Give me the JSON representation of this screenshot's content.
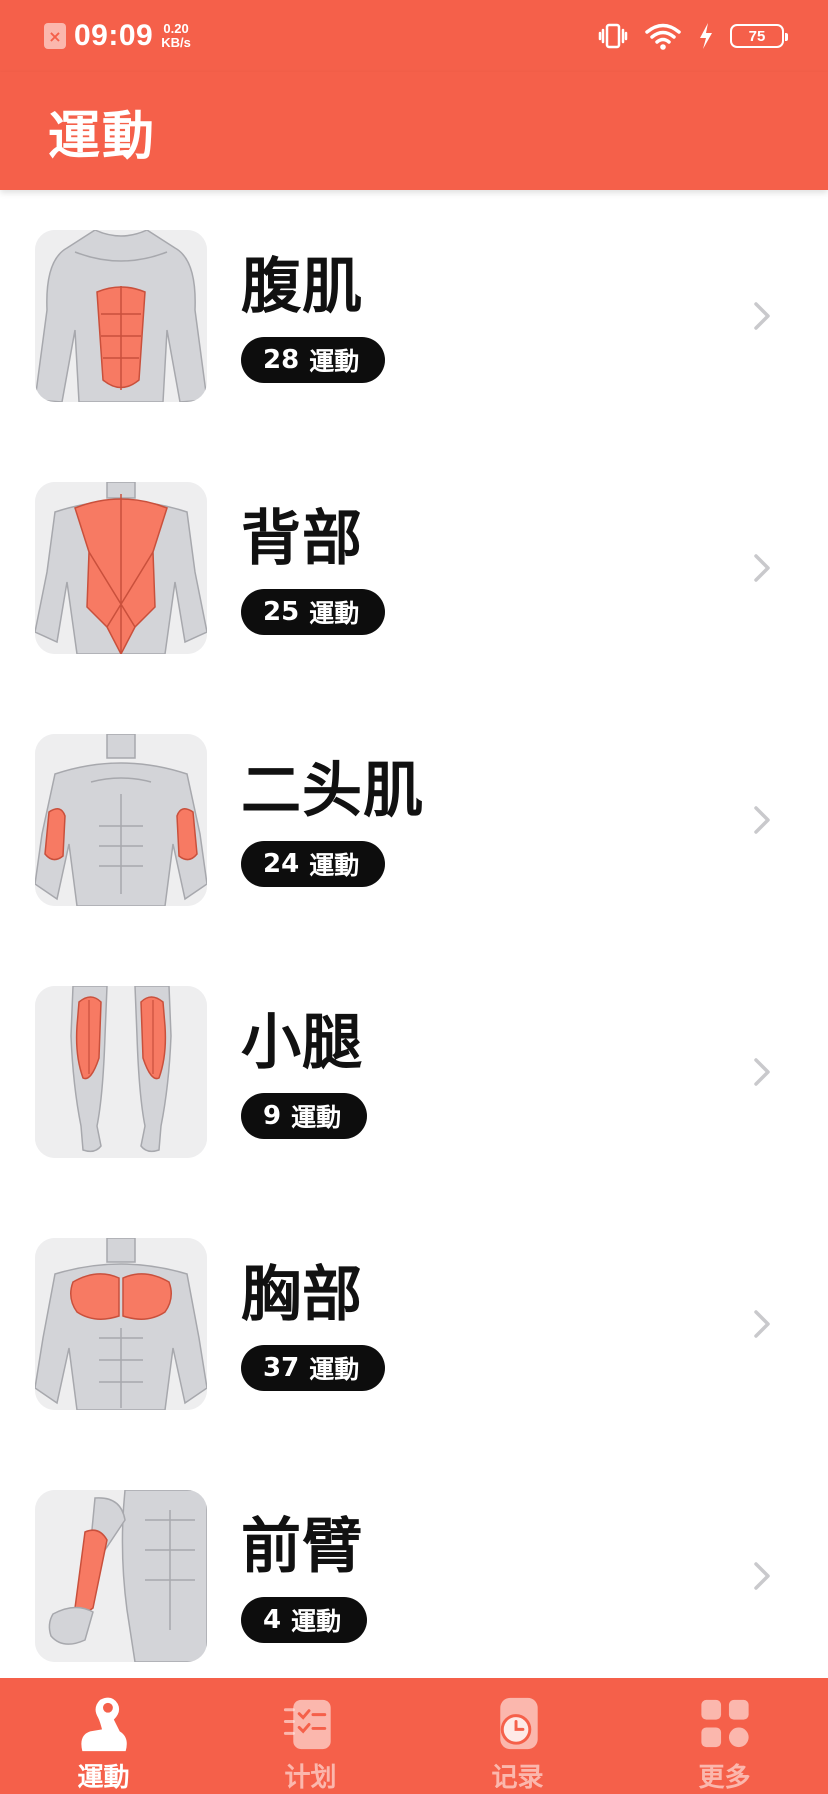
{
  "status_bar": {
    "time": "09:09",
    "net_speed_value": "0.20",
    "net_speed_unit": "KB/s",
    "battery": "75",
    "icons": [
      "sim-off-icon",
      "vibrate-icon",
      "wifi-icon",
      "charging-icon",
      "battery-icon"
    ]
  },
  "app_bar": {
    "title": "運動"
  },
  "list": {
    "items": [
      {
        "title": "腹肌",
        "count": "28",
        "unit": "運動",
        "icon": "abs-muscle-icon"
      },
      {
        "title": "背部",
        "count": "25",
        "unit": "運動",
        "icon": "back-muscle-icon"
      },
      {
        "title": "二头肌",
        "count": "24",
        "unit": "運動",
        "icon": "biceps-muscle-icon"
      },
      {
        "title": "小腿",
        "count": "9",
        "unit": "運動",
        "icon": "calf-muscle-icon"
      },
      {
        "title": "胸部",
        "count": "37",
        "unit": "運動",
        "icon": "chest-muscle-icon"
      },
      {
        "title": "前臂",
        "count": "4",
        "unit": "運動",
        "icon": "forearm-muscle-icon"
      }
    ]
  },
  "bottom_nav": {
    "active_tab": "運動",
    "tabs": [
      {
        "label": "運動",
        "icon": "muscle-arm-icon"
      },
      {
        "label": "计划",
        "icon": "plan-checklist-icon"
      },
      {
        "label": "记录",
        "icon": "history-clock-icon"
      },
      {
        "label": "更多",
        "icon": "grid-more-icon"
      }
    ]
  },
  "colors": {
    "brand": "#f5604a",
    "muscle_highlight": "#f77a63",
    "body_gray": "#d3d4d8",
    "badge_bg": "#0d0d0d"
  }
}
